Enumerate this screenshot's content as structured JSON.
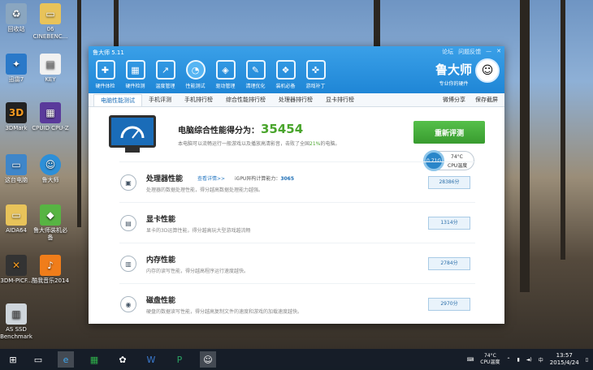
{
  "desktop_icons": [
    {
      "id": "recycle",
      "label": "回收站",
      "icon": "recycle-bin-icon"
    },
    {
      "id": "folder06",
      "label": "06 CINEBENC...",
      "icon": "folder-icon"
    },
    {
      "id": "xunlei",
      "label": "迅雷7",
      "icon": "thunder-icon"
    },
    {
      "id": "key",
      "label": "KEY",
      "icon": "file-icon"
    },
    {
      "id": "3dmark",
      "label": "3DMark",
      "icon": "3dmark-icon"
    },
    {
      "id": "cpuz",
      "label": "CPUID CPU-Z",
      "icon": "cpuz-icon"
    },
    {
      "id": "thispc",
      "label": "这台电脑",
      "icon": "computer-icon"
    },
    {
      "id": "ludashi",
      "label": "鲁大师",
      "icon": "ludashi-icon"
    },
    {
      "id": "aida",
      "label": "AIDA64",
      "icon": "folder-icon"
    },
    {
      "id": "ludashi-phone",
      "label": "鲁大师装机必备",
      "icon": "ludashi-phone-icon"
    },
    {
      "id": "3dmpic",
      "label": "3DM-PICF...",
      "icon": "3dm-icon"
    },
    {
      "id": "kugou",
      "label": "酷我音乐2014",
      "icon": "music-icon"
    },
    {
      "id": "asssd",
      "label": "AS SSD Benchmark",
      "icon": "ssd-icon"
    }
  ],
  "app": {
    "title": "鲁大师 5.11",
    "window_controls": [
      "论坛",
      "问题反馈",
      "—",
      "✕"
    ],
    "nav": [
      {
        "label": "硬件体检",
        "icon": "health-check-icon"
      },
      {
        "label": "硬件检测",
        "icon": "hardware-detect-icon"
      },
      {
        "label": "温度管理",
        "icon": "temperature-icon"
      },
      {
        "label": "性能测试",
        "icon": "performance-icon",
        "active": true
      },
      {
        "label": "驱动管理",
        "icon": "driver-icon"
      },
      {
        "label": "清理优化",
        "icon": "broom-icon"
      },
      {
        "label": "装机必备",
        "icon": "install-icon"
      },
      {
        "label": "游戏补丁",
        "icon": "gamepad-icon"
      }
    ],
    "brand_name": "鲁大师",
    "brand_slogan": "专业你的硬件",
    "tabs": [
      "电脑性能测试",
      "手机评测",
      "手机排行榜",
      "综合性能排行榜",
      "处理器排行榜",
      "显卡排行榜"
    ],
    "tab_tools": [
      "微博分享",
      "保存截屏"
    ],
    "score_label": "电脑综合性能得分为：",
    "score_value": "35454",
    "score_desc_pre": "本电脑可以流畅运行一般游戏以及播放高清影音，击败了全国",
    "score_pct": "21%",
    "score_desc_post": "的电脑。",
    "retest_label": "重新评测",
    "temp_widget": {
      "gauge": "0.71G",
      "temp": "74°C",
      "label": "CPU温度"
    },
    "sections": [
      {
        "title": "处理器性能",
        "desc": "处理器的数据处理性能，得分越高数据处理能力越强。",
        "score": "28386分",
        "icon": "cpu-icon",
        "link": "查看详情>>",
        "igpu_label": "iGPU异构计算能力：",
        "igpu_value": "3065"
      },
      {
        "title": "显卡性能",
        "desc": "显卡的3D运算性能，得分越高玩大型游戏越流畅",
        "score": "1314分",
        "icon": "gpu-icon"
      },
      {
        "title": "内存性能",
        "desc": "内存的读写性能，得分越高程序运行速度越快。",
        "score": "2784分",
        "icon": "memory-icon"
      },
      {
        "title": "磁盘性能",
        "desc": "硬盘的数据读写性能，得分越高复制文件的速度和游戏的加载速度越快。",
        "score": "2970分",
        "icon": "disk-icon"
      }
    ]
  },
  "taskbar": {
    "items": [
      "windows-start-icon",
      "file-explorer-icon",
      "ie-icon",
      "store-icon",
      "app-icon",
      "word-icon",
      "publisher-icon",
      "ludashi-taskbar-icon"
    ],
    "tray_temp": "74°C",
    "tray_temp_label": "CPU温度",
    "time": "13:57",
    "date": "2015/4/24"
  }
}
